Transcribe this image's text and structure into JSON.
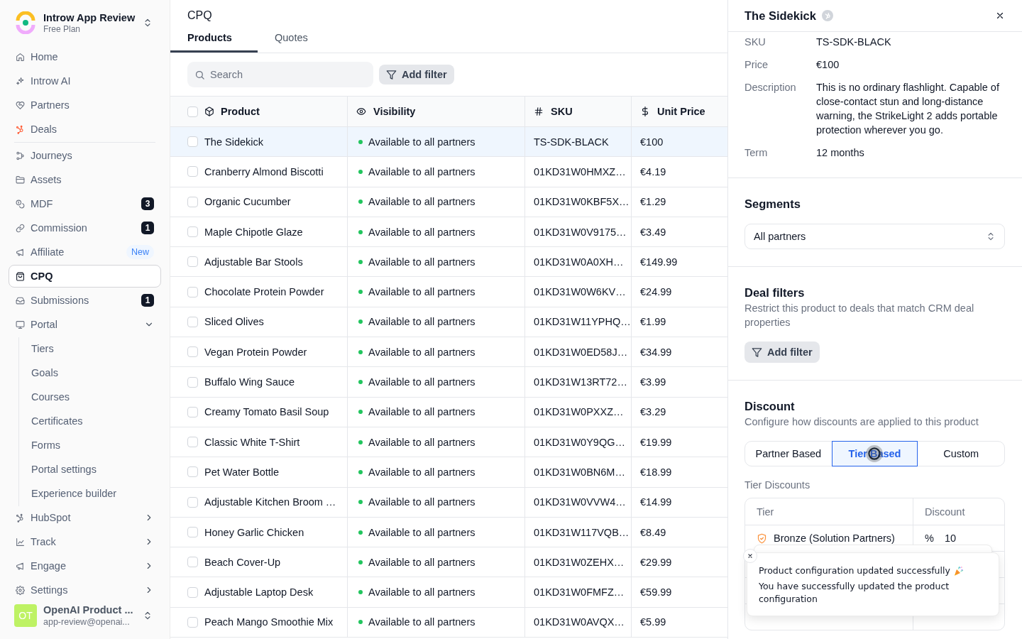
{
  "sidebar": {
    "workspace": {
      "name": "Introw App Review",
      "plan": "Free Plan"
    },
    "nav_groups": [
      [
        {
          "label": "Home",
          "selected": false
        },
        {
          "label": "Introw AI",
          "selected": false
        },
        {
          "label": "Partners",
          "selected": false
        },
        {
          "label": "Deals",
          "selected": false
        }
      ],
      [
        {
          "label": "Journeys",
          "selected": false
        },
        {
          "label": "Assets",
          "selected": false
        },
        {
          "label": "MDF",
          "selected": false,
          "badge": {
            "text": "3",
            "kind": "count"
          }
        },
        {
          "label": "Commission",
          "selected": false,
          "badge": {
            "text": "1",
            "kind": "count"
          }
        },
        {
          "label": "Affiliate",
          "selected": false,
          "badge": {
            "text": "New",
            "kind": "new"
          }
        },
        {
          "label": "CPQ",
          "selected": true
        },
        {
          "label": "Submissions",
          "selected": false,
          "badge": {
            "text": "1",
            "kind": "count"
          }
        },
        {
          "label": "Portal",
          "selected": false,
          "expanded": true,
          "children": [
            {
              "label": "Tiers",
              "selected": false
            },
            {
              "label": "Goals",
              "selected": false
            },
            {
              "label": "Courses",
              "selected": false
            },
            {
              "label": "Certificates",
              "selected": false
            },
            {
              "label": "Forms",
              "selected": false
            },
            {
              "label": "Portal settings",
              "selected": false
            },
            {
              "label": "Experience builder",
              "selected": false
            }
          ]
        },
        {
          "label": "HubSpot",
          "selected": false,
          "expanded": false
        },
        {
          "label": "Track",
          "selected": false,
          "expanded": false
        },
        {
          "label": "Engage",
          "selected": false,
          "expanded": false
        },
        {
          "label": "Settings",
          "selected": false,
          "expanded": false
        }
      ]
    ],
    "user": {
      "initials": "OT",
      "name": "OpenAI Product ...",
      "email": "app-review@openai..."
    }
  },
  "main": {
    "title": "CPQ",
    "tabs": [
      {
        "label": "Products",
        "selected": true
      },
      {
        "label": "Quotes",
        "selected": false
      }
    ],
    "search": {
      "placeholder": "Search"
    },
    "add_filter": "Add filter",
    "table": {
      "all_checked": false,
      "columns": [
        "Product",
        "Visibility",
        "SKU",
        "Unit Price"
      ],
      "rows": [
        {
          "product": "The Sidekick",
          "visibility": "Available to all partners",
          "sku": "TS-SDK-BLACK",
          "unit_price": "€100",
          "checked": false,
          "selected": true
        },
        {
          "product": "Cranberry Almond Biscotti",
          "visibility": "Available to all partners",
          "sku": "01KD31W0HMXZ…",
          "unit_price": "€4.19",
          "checked": false,
          "selected": false
        },
        {
          "product": "Organic Cucumber",
          "visibility": "Available to all partners",
          "sku": "01KD31W0KBF5X…",
          "unit_price": "€1.29",
          "checked": false,
          "selected": false
        },
        {
          "product": "Maple Chipotle Glaze",
          "visibility": "Available to all partners",
          "sku": "01KD31W0V9175…",
          "unit_price": "€3.49",
          "checked": false,
          "selected": false
        },
        {
          "product": "Adjustable Bar Stools",
          "visibility": "Available to all partners",
          "sku": "01KD31W0A0XH…",
          "unit_price": "€149.99",
          "checked": false,
          "selected": false
        },
        {
          "product": "Chocolate Protein Powder",
          "visibility": "Available to all partners",
          "sku": "01KD31W0W6KV…",
          "unit_price": "€24.99",
          "checked": false,
          "selected": false
        },
        {
          "product": "Sliced Olives",
          "visibility": "Available to all partners",
          "sku": "01KD31W11YPHQ…",
          "unit_price": "€1.99",
          "checked": false,
          "selected": false
        },
        {
          "product": "Vegan Protein Powder",
          "visibility": "Available to all partners",
          "sku": "01KD31W0ED58J…",
          "unit_price": "€34.99",
          "checked": false,
          "selected": false
        },
        {
          "product": "Buffalo Wing Sauce",
          "visibility": "Available to all partners",
          "sku": "01KD31W13RT72…",
          "unit_price": "€3.99",
          "checked": false,
          "selected": false
        },
        {
          "product": "Creamy Tomato Basil Soup",
          "visibility": "Available to all partners",
          "sku": "01KD31W0PXXZ…",
          "unit_price": "€3.29",
          "checked": false,
          "selected": false
        },
        {
          "product": "Classic White T-Shirt",
          "visibility": "Available to all partners",
          "sku": "01KD31W0Y9QG…",
          "unit_price": "€19.99",
          "checked": false,
          "selected": false
        },
        {
          "product": "Pet Water Bottle",
          "visibility": "Available to all partners",
          "sku": "01KD31W0BN6M…",
          "unit_price": "€18.99",
          "checked": false,
          "selected": false
        },
        {
          "product": "Adjustable Kitchen Broom …",
          "visibility": "Available to all partners",
          "sku": "01KD31W0VVW4…",
          "unit_price": "€14.99",
          "checked": false,
          "selected": false
        },
        {
          "product": "Honey Garlic Chicken",
          "visibility": "Available to all partners",
          "sku": "01KD31W117VQB…",
          "unit_price": "€8.49",
          "checked": false,
          "selected": false
        },
        {
          "product": "Beach Cover-Up",
          "visibility": "Available to all partners",
          "sku": "01KD31W0ZEHX…",
          "unit_price": "€29.99",
          "checked": false,
          "selected": false
        },
        {
          "product": "Adjustable Laptop Desk",
          "visibility": "Available to all partners",
          "sku": "01KD31W0FMFZ…",
          "unit_price": "€59.99",
          "checked": false,
          "selected": false
        },
        {
          "product": "Peach Mango Smoothie Mix",
          "visibility": "Available to all partners",
          "sku": "01KD31W0AVQX…",
          "unit_price": "€5.99",
          "checked": false,
          "selected": false
        }
      ]
    }
  },
  "detail_panel": {
    "title": "The Sidekick",
    "fields": [
      {
        "label": "SKU",
        "value": "TS-SDK-BLACK"
      },
      {
        "label": "Price",
        "value": "€100"
      },
      {
        "label": "Description",
        "value": "This is no ordinary flashlight. Capable of close-contact stun and long-distance warning, the StrikeLight 2 adds portable protection wherever you go."
      },
      {
        "label": "Term",
        "value": "12 months"
      }
    ],
    "segments": {
      "title": "Segments",
      "value": "All partners"
    },
    "deal_filters": {
      "title": "Deal filters",
      "description": "Restrict this product to deals that match CRM deal properties",
      "button": "Add filter"
    },
    "discount": {
      "title": "Discount",
      "description": "Configure how discounts are applied to this product",
      "modes": [
        {
          "label": "Partner Based",
          "selected": false
        },
        {
          "label": "Tier Based",
          "selected": true
        },
        {
          "label": "Custom",
          "selected": false
        }
      ],
      "table_label": "Tier Discounts",
      "columns": [
        "Tier",
        "Discount"
      ],
      "rows": [
        {
          "tier": "Bronze (Solution Partners)",
          "unit": "%",
          "value": "10",
          "color": "#fb923c"
        }
      ]
    }
  },
  "toast": {
    "title": "Product configuration updated successfully",
    "message": "You have successfully updated the product configuration"
  }
}
